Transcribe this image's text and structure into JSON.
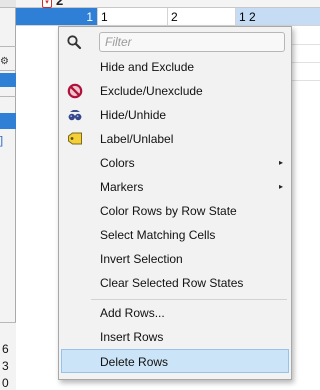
{
  "table": {
    "header_digit": "2",
    "row": {
      "row_number": "1",
      "col1": "1",
      "col2": "2",
      "col3": "1 2"
    },
    "left_values": [
      "6",
      "3",
      "0"
    ]
  },
  "menu": {
    "filter_placeholder": "Filter",
    "items": [
      {
        "label": "Hide and Exclude"
      },
      {
        "label": "Exclude/Unexclude"
      },
      {
        "label": "Hide/Unhide"
      },
      {
        "label": "Label/Unlabel"
      },
      {
        "label": "Colors"
      },
      {
        "label": "Markers"
      },
      {
        "label": "Color Rows by Row State"
      },
      {
        "label": "Select Matching Cells"
      },
      {
        "label": "Invert Selection"
      },
      {
        "label": "Clear Selected Row States"
      },
      {
        "label": "Add Rows..."
      },
      {
        "label": "Insert Rows"
      },
      {
        "label": "Delete Rows"
      }
    ],
    "submenu_arrow": "▸",
    "highlight_color": "#cce4f7"
  },
  "colors": {
    "selection_blue": "#2f7fd6",
    "menu_background": "#f2f2f2"
  }
}
